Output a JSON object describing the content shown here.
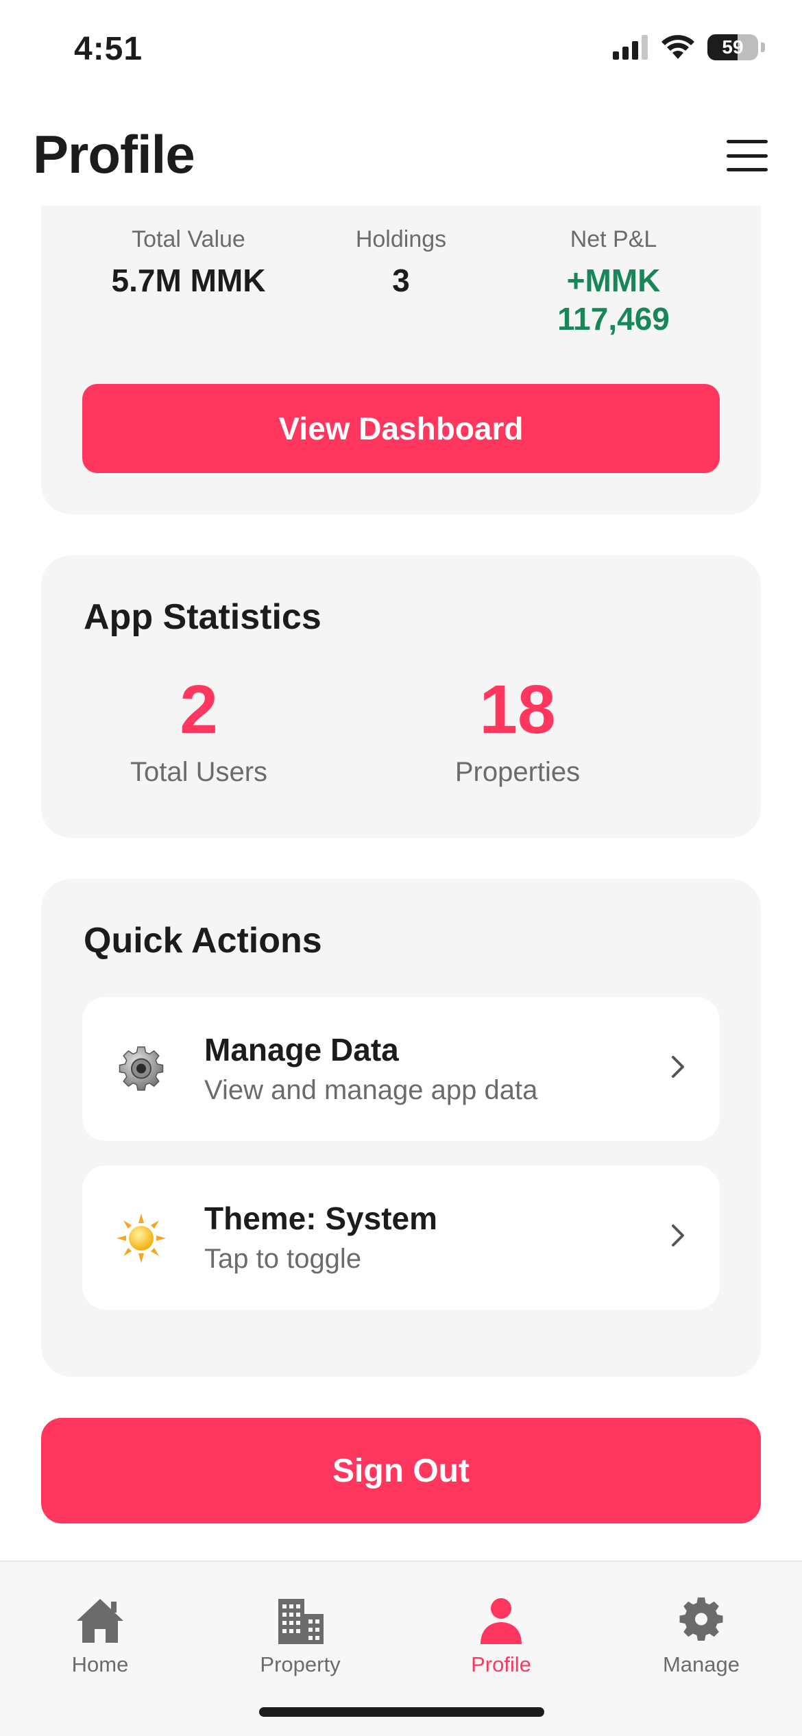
{
  "status_bar": {
    "time": "4:51",
    "battery": "59",
    "battery_level": 0.59,
    "icons": [
      "signal-icon",
      "wifi-icon",
      "battery-icon"
    ]
  },
  "header": {
    "title": "Profile",
    "menu_icon": "hamburger-menu-icon"
  },
  "portfolio": {
    "metrics": [
      {
        "label": "Total Value",
        "value": "5.7M MMK"
      },
      {
        "label": "Holdings",
        "value": "3"
      },
      {
        "label": "Net P&L",
        "value": "+MMK 117,469"
      }
    ],
    "button_label": "View Dashboard"
  },
  "app_statistics": {
    "title": "App Statistics",
    "stats": [
      {
        "number": "2",
        "label": "Total Users"
      },
      {
        "number": "18",
        "label": "Properties"
      }
    ]
  },
  "quick_actions": {
    "title": "Quick Actions",
    "items": [
      {
        "title": "Manage Data",
        "subtitle": "View and manage app data",
        "icon": "gear-icon"
      },
      {
        "title": "Theme: System",
        "subtitle": "Tap to toggle",
        "icon": "sun-icon"
      }
    ]
  },
  "sign_out_label": "Sign Out",
  "tab_bar": {
    "active": "Profile",
    "tabs": [
      {
        "label": "Home",
        "icon": "home-icon"
      },
      {
        "label": "Property",
        "icon": "building-icon"
      },
      {
        "label": "Profile",
        "icon": "person-icon"
      },
      {
        "label": "Manage",
        "icon": "gear-icon"
      }
    ]
  },
  "colors": {
    "accent": "#ff375f",
    "positive": "#17875a",
    "card_background": "#f5f5f5",
    "muted_text": "#6b6b6b"
  }
}
